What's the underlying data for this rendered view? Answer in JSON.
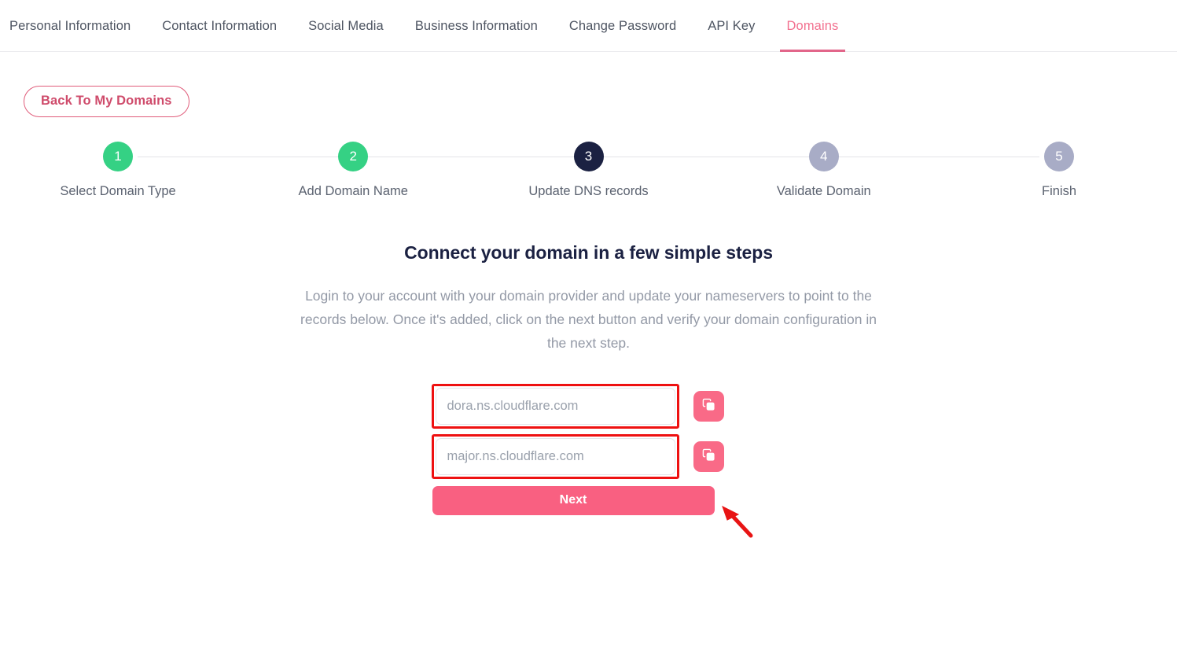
{
  "tabs": [
    {
      "label": "Personal Information",
      "active": false
    },
    {
      "label": "Contact Information",
      "active": false
    },
    {
      "label": "Social Media",
      "active": false
    },
    {
      "label": "Business Information",
      "active": false
    },
    {
      "label": "Change Password",
      "active": false
    },
    {
      "label": "API Key",
      "active": false
    },
    {
      "label": "Domains",
      "active": true
    }
  ],
  "back_button": {
    "label": "Back To My Domains"
  },
  "stepper": {
    "steps": [
      {
        "number": "1",
        "label": "Select Domain Type",
        "state": "done"
      },
      {
        "number": "2",
        "label": "Add Domain Name",
        "state": "done"
      },
      {
        "number": "3",
        "label": "Update DNS records",
        "state": "current"
      },
      {
        "number": "4",
        "label": "Validate Domain",
        "state": "todo"
      },
      {
        "number": "5",
        "label": "Finish",
        "state": "todo"
      }
    ]
  },
  "panel": {
    "headline": "Connect your domain in a few simple steps",
    "subtext": "Login to your account with your domain provider and update your nameservers to point to the records below. Once it's added, click on the next button and verify your domain configuration in the next step."
  },
  "form": {
    "nameservers": [
      {
        "placeholder": "dora.ns.cloudflare.com",
        "value": "",
        "copy_icon": "copy-icon"
      },
      {
        "placeholder": "major.ns.cloudflare.com",
        "value": "",
        "copy_icon": "copy-icon"
      }
    ],
    "next_label": "Next"
  },
  "colors": {
    "accent_pink": "#f96081",
    "tab_active": "#f2708f",
    "step_done": "#35d184",
    "step_current": "#1b2142",
    "step_todo": "#a8acc6",
    "annotation_red": "#ee1111",
    "back_border": "#e05c7a"
  }
}
